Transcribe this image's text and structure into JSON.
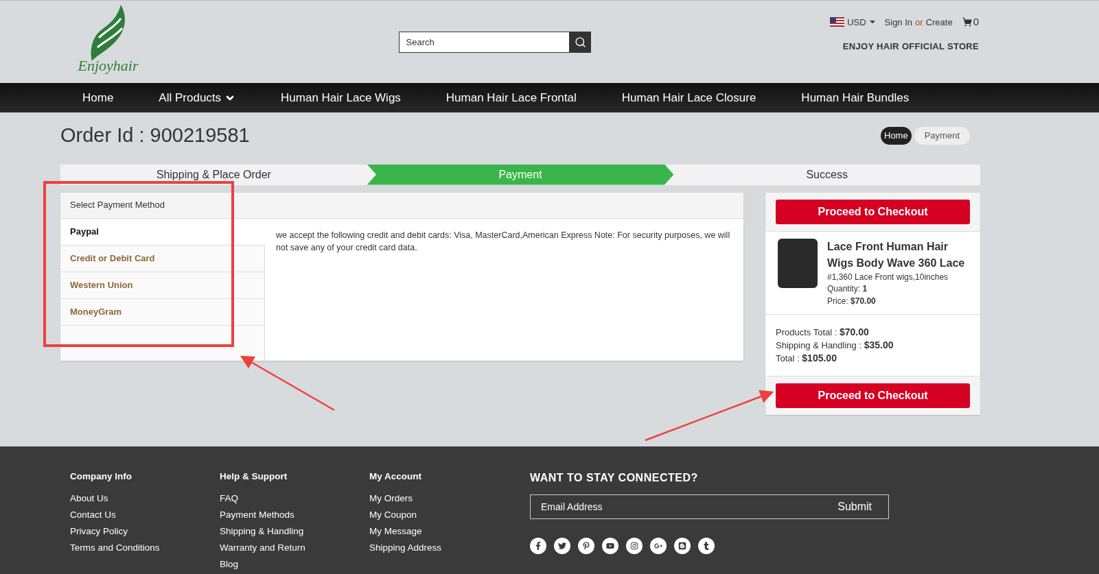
{
  "header": {
    "logo_text": "Enjoyhair",
    "search": {
      "placeholder": "Search"
    },
    "currency": "USD",
    "sign_in": "Sign In",
    "or": "or",
    "create": "Create",
    "cart_count": "0",
    "store_name": "ENJOY HAIR OFFICIAL STORE"
  },
  "nav": [
    {
      "label": "Home",
      "dropdown": false
    },
    {
      "label": "All Products",
      "dropdown": true
    },
    {
      "label": "Human Hair Lace Wigs",
      "dropdown": false
    },
    {
      "label": "Human Hair Lace Frontal",
      "dropdown": false
    },
    {
      "label": "Human Hair Lace Closure",
      "dropdown": false
    },
    {
      "label": "Human Hair Bundles",
      "dropdown": false
    }
  ],
  "order_title": "Order Id : 900219581",
  "breadcrumb": [
    {
      "label": "Home",
      "selected": true
    },
    {
      "label": "Payment",
      "selected": false
    }
  ],
  "steps": [
    {
      "label": "Shipping & Place Order",
      "selected": false
    },
    {
      "label": "Payment",
      "selected": true
    },
    {
      "label": "Success",
      "selected": false
    }
  ],
  "payment": {
    "heading": "Select Payment Method",
    "methods": [
      {
        "label": "Paypal",
        "selected": true
      },
      {
        "label": "Credit or Debit Card",
        "selected": false
      },
      {
        "label": "Western Union",
        "selected": false
      },
      {
        "label": "MoneyGram",
        "selected": false
      }
    ],
    "description": "we accept the following credit and debit cards: Visa, MasterCard,American Express  Note: For security purposes, we will not save any of your credit card data."
  },
  "summary": {
    "checkout_button": "Proceed to Checkout",
    "product": {
      "name": "Lace Front Human Hair Wigs Body Wave 360 Lace",
      "variant": "#1,360 Lace Front wigs,10inches",
      "quantity_label": "Quantity:",
      "quantity": "1",
      "price_label": "Price:",
      "price": "$70.00"
    },
    "totals": [
      {
        "label": "Products Total :",
        "value": "$70.00"
      },
      {
        "label": "Shipping & Handling :",
        "value": "$35.00"
      },
      {
        "label": "Total :",
        "value": "$105.00"
      }
    ],
    "checkout_button_bottom": "Proceed to Checkout"
  },
  "footer": {
    "columns": [
      {
        "title": "Company Info",
        "links": [
          "About Us",
          "Contact Us",
          "Privacy Policy",
          "Terms and Conditions"
        ]
      },
      {
        "title": "Help & Support",
        "links": [
          "FAQ",
          "Payment Methods",
          "Shipping & Handling",
          "Warranty and Return",
          "Blog"
        ]
      },
      {
        "title": "My Account",
        "links": [
          "My Orders",
          "My Coupon",
          "My Message",
          "Shipping Address"
        ]
      }
    ],
    "newsletter_title": "WANT TO STAY CONNECTED?",
    "email_placeholder": "Email Address",
    "submit": "Submit",
    "social": [
      {
        "kind": "facebook"
      },
      {
        "kind": "twitter"
      },
      {
        "kind": "pinterest"
      },
      {
        "kind": "youtube"
      },
      {
        "kind": "instagram"
      },
      {
        "kind": "google-plus"
      },
      {
        "kind": "blogger"
      },
      {
        "kind": "tumblr"
      }
    ]
  }
}
